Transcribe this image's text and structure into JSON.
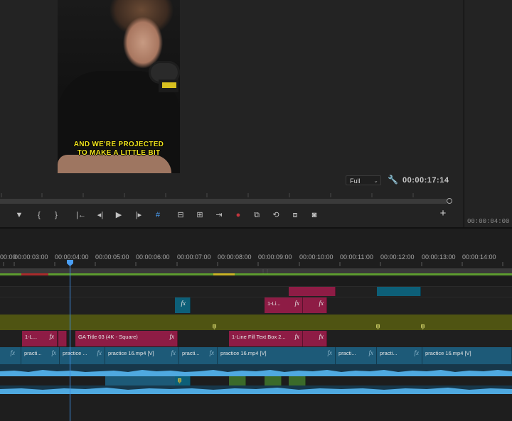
{
  "program_monitor": {
    "caption_line1": "AND WE'RE PROJECTED",
    "caption_line2": "TO MAKE A LITTLE BIT",
    "zoom_level": "Full",
    "timecode": "00:00:17:14",
    "icons": [
      "marker-icon",
      "in-point-icon",
      "out-point-icon",
      "go-to-in-icon",
      "step-back-icon",
      "play-icon",
      "step-forward-icon",
      "go-to-out-icon",
      "safe-margins-icon",
      "lift-icon",
      "extract-icon",
      "insert-icon",
      "record-icon",
      "multicam-icon",
      "vr-icon",
      "compare-icon",
      "export-frame-icon",
      "add-button-icon"
    ],
    "control_glyphs": {
      "marker": "▼",
      "in": "{",
      "out": "}",
      "go_in": "|←",
      "step_back": "◂|",
      "play": "▶",
      "step_fwd": "|▸",
      "go_out": "→|",
      "safe": "#",
      "lift": "⊟",
      "extract": "⊞",
      "insert": "⇥",
      "record": "●",
      "multicam": "⧉",
      "vr": "⟲",
      "compare": "⧈",
      "camera": "◙",
      "add": "+"
    }
  },
  "source_panel": {
    "timecode": "00:00:04:00"
  },
  "timeline": {
    "ruler_labels": [
      "00:00",
      "00:00:03:00",
      "00:00:04:00",
      "00:00:05:00",
      "00:00:06:00",
      "00:00:07:00",
      "00:00:08:00",
      "00:00:09:00",
      "00:00:10:00",
      "00:00:11:00",
      "00:00:12:00",
      "00:00:13:00",
      "00:00:14:00"
    ],
    "clips": {
      "v4_fx": "fx",
      "v4_label": "1-Li...",
      "v2_a_label": "1-L...",
      "v2_b_label": "GA Title 03 (4K - Square)",
      "v2_c_label": "1-Line Fill Text Box 2...",
      "v1_labels": [
        "practi...",
        "practice ...",
        "practice 16.mp4 [V]",
        "practi...",
        "practice 16.mp4 [V]",
        "practi...",
        "practi...",
        "practice 16.mp4 [V]"
      ],
      "fx": "fx"
    }
  },
  "colors": {
    "graphic_clip": "#8e1c45",
    "video_clip": "#1d5a78",
    "adjustment_clip": "#4f5412",
    "audio_wave": "#4fa9e0",
    "playhead": "#3d8ce0",
    "caption": "#f2e51e"
  }
}
